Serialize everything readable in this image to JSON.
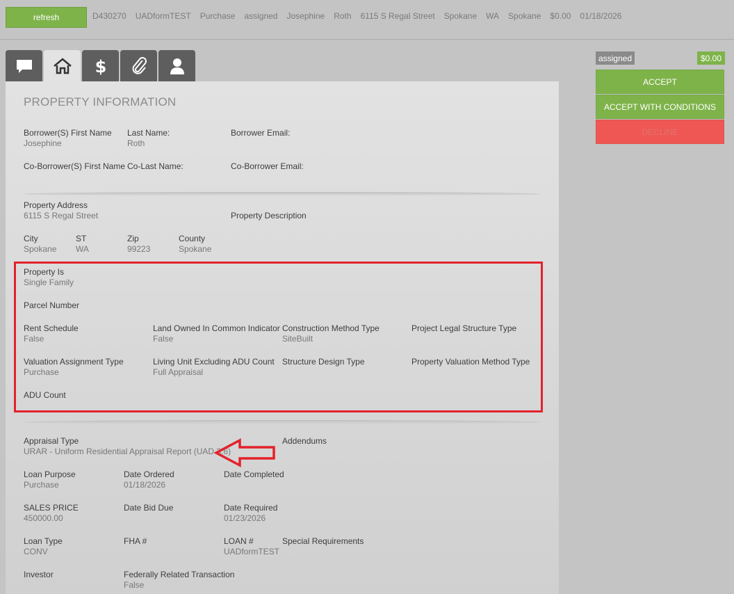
{
  "topbar": {
    "refresh_label": "refresh",
    "summary": [
      "D430270",
      "UADformTEST",
      "Purchase",
      "assigned",
      "Josephine",
      "Roth",
      "6115 S Regal Street",
      "Spokane",
      "WA",
      "Spokane",
      "$0.00",
      "01/18/2026"
    ]
  },
  "tabs": [
    {
      "icon": "message-icon"
    },
    {
      "icon": "home-icon"
    },
    {
      "icon": "dollar-icon"
    },
    {
      "icon": "paperclip-icon"
    },
    {
      "icon": "user-icon"
    }
  ],
  "section": {
    "title": "PROPERTY INFORMATION"
  },
  "borrower": {
    "first_name_label": "Borrower(S) First Name",
    "first_name": "Josephine",
    "last_name_label": "Last Name:",
    "last_name": "Roth",
    "email_label": "Borrower Email:",
    "co_first_label": "Co-Borrower(S) First Name",
    "co_last_label": "Co-Last Name:",
    "co_email_label": "Co-Borrower Email:"
  },
  "property": {
    "address_label": "Property Address",
    "address": "6115 S Regal Street",
    "description_label": "Property Description",
    "city_label": "City",
    "city": "Spokane",
    "st_label": "ST",
    "st": "WA",
    "zip_label": "Zip",
    "zip": "99223",
    "county_label": "County",
    "county": "Spokane"
  },
  "uad": {
    "property_is_label": "Property Is",
    "property_is": "Single Family",
    "parcel_label": "Parcel Number",
    "rent_label": "Rent Schedule",
    "rent": "False",
    "land_label": "Land Owned In Common Indicator",
    "land": "False",
    "construction_label": "Construction Method Type",
    "construction": "SiteBuilt",
    "project_label": "Project Legal Structure Type",
    "valuation_assign_label": "Valuation Assignment Type",
    "valuation_assign": "Purchase",
    "living_label": "Living Unit Excluding ADU Count",
    "living": "Full Appraisal",
    "structure_label": "Structure Design Type",
    "valuation_method_label": "Property Valuation Method Type",
    "adu_label": "ADU Count"
  },
  "order": {
    "appraisal_type_label": "Appraisal Type",
    "appraisal_type": "URAR - Uniform Residential Appraisal Report (UAD 3.6)",
    "addendums_label": "Addendums",
    "loan_purpose_label": "Loan Purpose",
    "loan_purpose": "Purchase",
    "date_ordered_label": "Date Ordered",
    "date_ordered": "01/18/2026",
    "date_completed_label": "Date Completed",
    "sales_price_label": "SALES PRICE",
    "sales_price": "450000.00",
    "date_bid_label": "Date Bid Due",
    "date_required_label": "Date Required",
    "date_required": "01/23/2026",
    "loan_type_label": "Loan Type",
    "loan_type": "CONV",
    "fha_label": "FHA #",
    "loan_no_label": "LOAN #",
    "loan_no": "UADformTEST",
    "special_label": "Special Requirements",
    "investor_label": "Investor",
    "federal_label": "Federally Related Transaction",
    "federal": "False"
  },
  "sidebar": {
    "status": "assigned",
    "amount": "$0.00",
    "accept_label": "ACCEPT",
    "accept_conditions_label": "ACCEPT WITH CONDITIONS",
    "decline_label": "DECLINE"
  },
  "colors": {
    "green": "#7eb34a",
    "red": "#ee5753",
    "highlight": "#e3222b"
  }
}
